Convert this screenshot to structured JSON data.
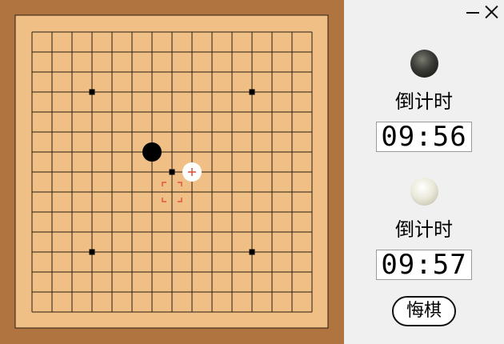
{
  "window": {
    "minimize_icon": "minimize-icon",
    "close_icon": "close-icon"
  },
  "board": {
    "size": 15,
    "star_points": [
      [
        3,
        3
      ],
      [
        11,
        3
      ],
      [
        7,
        7
      ],
      [
        3,
        11
      ],
      [
        11,
        11
      ]
    ],
    "stones": [
      {
        "col": 6,
        "row": 6,
        "color": "black"
      }
    ],
    "hover_marker": {
      "col": 8,
      "row": 7,
      "icon": "plus-cursor-icon"
    },
    "selection_marker": {
      "col": 7,
      "row": 8,
      "icon": "target-bracket-icon"
    },
    "colors": {
      "frame": "#b07440",
      "wood": "#efbf86",
      "line": "#2a1c10",
      "marker": "#e0533a"
    }
  },
  "players": {
    "black": {
      "stone_icon": "black-stone-icon",
      "countdown_label": "倒计时",
      "time": "09:56"
    },
    "white": {
      "stone_icon": "white-stone-icon",
      "countdown_label": "倒计时",
      "time": "09:57"
    }
  },
  "actions": {
    "undo_label": "悔棋"
  }
}
